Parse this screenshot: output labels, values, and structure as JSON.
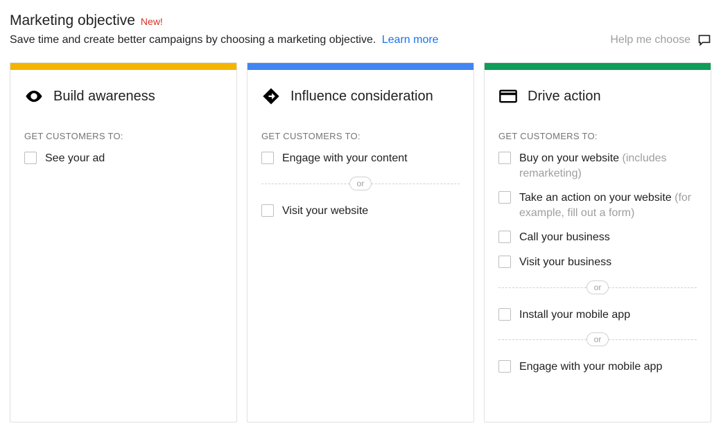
{
  "header": {
    "title": "Marketing objective",
    "badge": "New!",
    "subtitle": "Save time and create better campaigns by choosing a marketing objective.",
    "learn_more": "Learn more",
    "help": "Help me choose"
  },
  "section_label": "GET CUSTOMERS TO:",
  "or_label": "or",
  "colors": {
    "awareness": "#f4b400",
    "consideration": "#4285f4",
    "action": "#0f9d58"
  },
  "columns": {
    "awareness": {
      "title": "Build awareness",
      "options": [
        {
          "label": "See your ad",
          "hint": ""
        }
      ]
    },
    "consideration": {
      "title": "Influence consideration",
      "group1": [
        {
          "label": "Engage with your content",
          "hint": ""
        }
      ],
      "group2": [
        {
          "label": "Visit your website",
          "hint": ""
        }
      ]
    },
    "action": {
      "title": "Drive action",
      "group1": [
        {
          "label": "Buy on your website",
          "hint": " (includes remarketing)"
        },
        {
          "label": "Take an action on your website",
          "hint": " (for example, fill out a form)"
        },
        {
          "label": "Call your business",
          "hint": ""
        },
        {
          "label": "Visit your business",
          "hint": ""
        }
      ],
      "group2": [
        {
          "label": "Install your mobile app",
          "hint": ""
        }
      ],
      "group3": [
        {
          "label": "Engage with your mobile app",
          "hint": ""
        }
      ]
    }
  }
}
